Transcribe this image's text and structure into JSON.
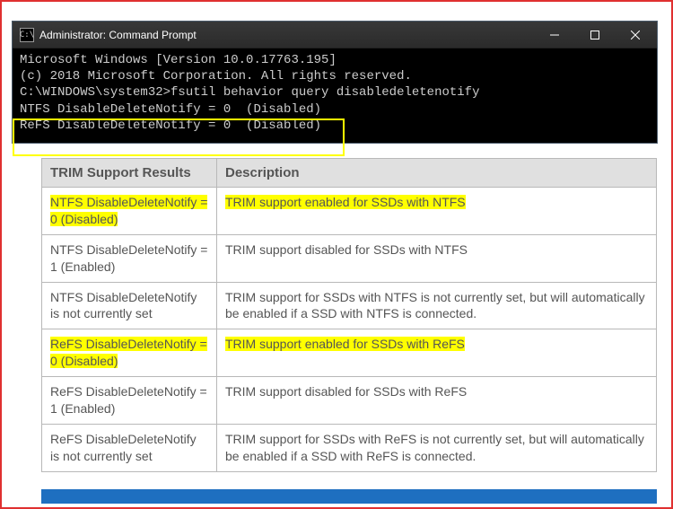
{
  "window": {
    "title": "Administrator: Command Prompt"
  },
  "console": {
    "line1": "Microsoft Windows [Version 10.0.17763.195]",
    "line2": "(c) 2018 Microsoft Corporation. All rights reserved.",
    "line3": "",
    "prompt": "C:\\WINDOWS\\system32>fsutil behavior query disabledeletenotify",
    "out1": "NTFS DisableDeleteNotify = 0  (Disabled)",
    "out2": "ReFS DisableDeleteNotify = 0  (Disabled)"
  },
  "table": {
    "headers": {
      "col1": "TRIM Support Results",
      "col2": "Description"
    },
    "rows": [
      {
        "result": "NTFS DisableDeleteNotify = 0 (Disabled)",
        "desc": "TRIM support enabled for SSDs with NTFS",
        "highlight": true
      },
      {
        "result": "NTFS DisableDeleteNotify = 1 (Enabled)",
        "desc": "TRIM support disabled for SSDs with NTFS",
        "highlight": false
      },
      {
        "result": "NTFS DisableDeleteNotify is not currently set",
        "desc": "TRIM support for SSDs with NTFS is not currently set, but will automatically be enabled if a SSD with NTFS is connected.",
        "highlight": false
      },
      {
        "result": "ReFS DisableDeleteNotify = 0 (Disabled)",
        "desc": "TRIM support enabled for SSDs with ReFS",
        "highlight": true
      },
      {
        "result": "ReFS DisableDeleteNotify = 1 (Enabled)",
        "desc": "TRIM support disabled for SSDs with ReFS",
        "highlight": false
      },
      {
        "result": "ReFS DisableDeleteNotify is not currently set",
        "desc": "TRIM support for SSDs with ReFS is not currently set, but will automatically be enabled if a SSD with ReFS is connected.",
        "highlight": false
      }
    ]
  }
}
